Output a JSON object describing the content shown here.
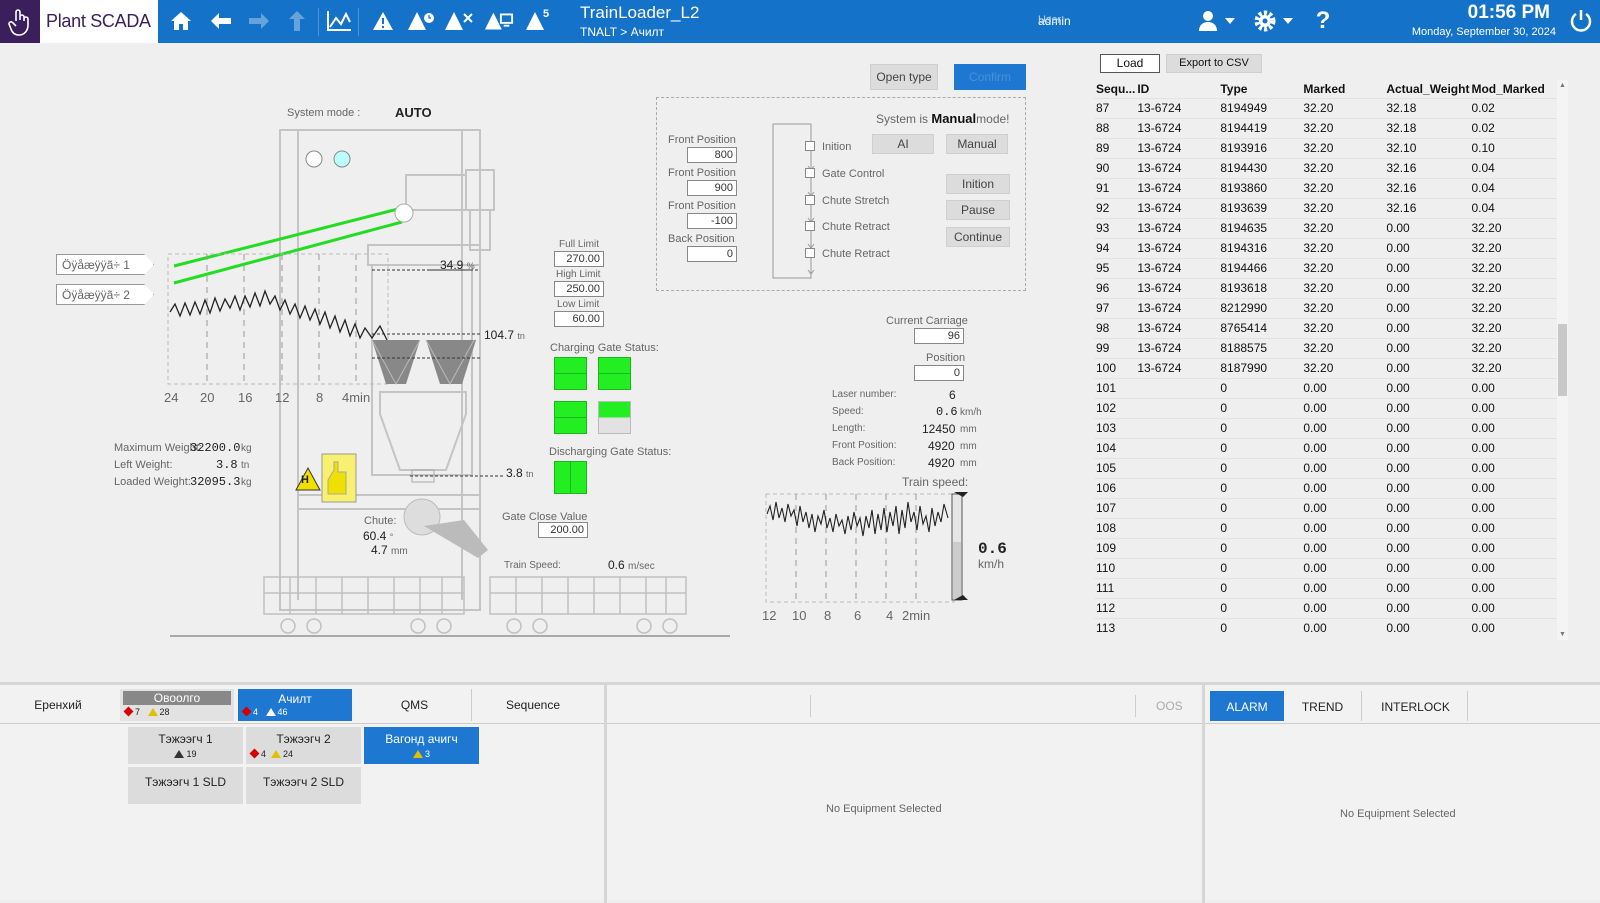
{
  "header": {
    "app_name": "Plant SCADA",
    "title": "TrainLoader_L2",
    "breadcrumb": "TNALT > Ачилт",
    "user_label": "User:",
    "user_name": "admin",
    "time": "01:56 PM",
    "date": "Monday, September 30, 2024",
    "alarm_count_badge": "5",
    "icons": [
      "home-icon",
      "back-icon",
      "forward-icon",
      "up-icon",
      "trend-icon",
      "alarm-icon",
      "alarm-clock-icon",
      "alarm-clear-icon",
      "alarm-screen-icon",
      "alarm-count-icon",
      "user-icon",
      "gear-icon",
      "help-icon",
      "power-icon"
    ]
  },
  "mimic": {
    "system_mode_label": "System mode :",
    "system_mode_value": "AUTO",
    "conveyor1_label": "Öÿåæÿÿã÷ 1",
    "conveyor2_label": "Öÿåæÿÿã÷ 2",
    "axis_ticks": [
      "24",
      "20",
      "16",
      "12",
      "8",
      "4min"
    ],
    "level_top": "34.9",
    "level_top_unit": "%",
    "level_mid": "104.7",
    "level_mid_unit": "tn",
    "level_bottom": "3.8",
    "level_bottom_unit": "tn",
    "max_weight_label": "Maximum Weight:",
    "max_weight_value": "32200.0",
    "max_weight_unit": "kg",
    "left_weight_label": "Left Weight:",
    "left_weight_value": "3.8",
    "left_weight_unit": "tn",
    "loaded_weight_label": "Loaded Weight:",
    "loaded_weight_value": "32095.3",
    "loaded_weight_unit": "kg",
    "hazard_letter": "H",
    "chute_label": "Chute:",
    "chute_angle": "60.4",
    "chute_angle_unit": "°",
    "chute_mm": "4.7",
    "chute_mm_unit": "mm"
  },
  "limits": {
    "full_label": "Full Limit",
    "full_value": "270.00",
    "high_label": "High Limit",
    "high_value": "250.00",
    "low_label": "Low Limit",
    "low_value": "60.00"
  },
  "gates": {
    "charging_label": "Charging Gate Status:",
    "discharging_label": "Discharging Gate Status:",
    "close_value_label": "Gate Close Value",
    "close_value": "200.00",
    "train_speed_label": "Train Speed:",
    "train_speed_value": "0.6",
    "train_speed_unit": "m/sec"
  },
  "control": {
    "open_type_label": "Open type",
    "confirm_label": "Confirm",
    "system_is_label": "System is",
    "system_is_mode": "Manual",
    "system_is_suffix": "mode!",
    "front_pos_label": "Front Position",
    "front_pos_1": "800",
    "front_pos_2": "900",
    "front_pos_3": "-100",
    "back_pos_label": "Back Position",
    "back_pos": "0",
    "steps": [
      "Inition",
      "Gate Control",
      "Chute Stretch",
      "Chute Retract",
      "Chute Retract"
    ],
    "ai_label": "AI",
    "manual_label": "Manual",
    "inition_label": "Inition",
    "pause_label": "Pause",
    "continue_label": "Continue"
  },
  "carriage": {
    "current_label": "Current Carriage",
    "current_value": "96",
    "position_label": "Position",
    "position_value": "0",
    "laser_label": "Laser number:",
    "laser_value": "6",
    "speed_label": "Speed:",
    "speed_value": "0.6",
    "speed_unit": "km/h",
    "length_label": "Length:",
    "length_value": "12450",
    "length_unit": "mm",
    "front_label": "Front Position:",
    "front_value": "4920",
    "front_unit": "mm",
    "back_label": "Back Position:",
    "back_value": "4920",
    "back_unit": "mm",
    "train_speed_title": "Train speed:",
    "gauge_value": "0.6",
    "gauge_unit": "km/h",
    "axis_ticks": [
      "12",
      "10",
      "8",
      "6",
      "4",
      "2min"
    ]
  },
  "table": {
    "load_label": "Load",
    "export_label": "Export to CSV",
    "columns": [
      "Sequ...",
      "ID",
      "Type",
      "Marked",
      "Actual_Weight",
      "Mod_Marked"
    ],
    "rows": [
      [
        "87",
        "13-6724",
        "8194949",
        "32.20",
        "32.18",
        "0.02"
      ],
      [
        "88",
        "13-6724",
        "8194419",
        "32.20",
        "32.18",
        "0.02"
      ],
      [
        "89",
        "13-6724",
        "8193916",
        "32.20",
        "32.10",
        "0.10"
      ],
      [
        "90",
        "13-6724",
        "8194430",
        "32.20",
        "32.16",
        "0.04"
      ],
      [
        "91",
        "13-6724",
        "8193860",
        "32.20",
        "32.16",
        "0.04"
      ],
      [
        "92",
        "13-6724",
        "8193639",
        "32.20",
        "32.16",
        "0.04"
      ],
      [
        "93",
        "13-6724",
        "8194635",
        "32.20",
        "0.00",
        "32.20"
      ],
      [
        "94",
        "13-6724",
        "8194316",
        "32.20",
        "0.00",
        "32.20"
      ],
      [
        "95",
        "13-6724",
        "8194466",
        "32.20",
        "0.00",
        "32.20"
      ],
      [
        "96",
        "13-6724",
        "8193618",
        "32.20",
        "0.00",
        "32.20"
      ],
      [
        "97",
        "13-6724",
        "8212990",
        "32.20",
        "0.00",
        "32.20"
      ],
      [
        "98",
        "13-6724",
        "8765414",
        "32.20",
        "0.00",
        "32.20"
      ],
      [
        "99",
        "13-6724",
        "8188575",
        "32.20",
        "0.00",
        "32.20"
      ],
      [
        "100",
        "13-6724",
        "8187990",
        "32.20",
        "0.00",
        "32.20"
      ],
      [
        "101",
        "",
        "0",
        "0.00",
        "0.00",
        "0.00"
      ],
      [
        "102",
        "",
        "0",
        "0.00",
        "0.00",
        "0.00"
      ],
      [
        "103",
        "",
        "0",
        "0.00",
        "0.00",
        "0.00"
      ],
      [
        "104",
        "",
        "0",
        "0.00",
        "0.00",
        "0.00"
      ],
      [
        "105",
        "",
        "0",
        "0.00",
        "0.00",
        "0.00"
      ],
      [
        "106",
        "",
        "0",
        "0.00",
        "0.00",
        "0.00"
      ],
      [
        "107",
        "",
        "0",
        "0.00",
        "0.00",
        "0.00"
      ],
      [
        "108",
        "",
        "0",
        "0.00",
        "0.00",
        "0.00"
      ],
      [
        "109",
        "",
        "0",
        "0.00",
        "0.00",
        "0.00"
      ],
      [
        "110",
        "",
        "0",
        "0.00",
        "0.00",
        "0.00"
      ],
      [
        "111",
        "",
        "0",
        "0.00",
        "0.00",
        "0.00"
      ],
      [
        "112",
        "",
        "0",
        "0.00",
        "0.00",
        "0.00"
      ],
      [
        "113",
        "",
        "0",
        "0.00",
        "0.00",
        "0.00"
      ]
    ]
  },
  "bottom": {
    "tabs": {
      "general": "Еренхий",
      "ovoolgo": "Овоолго",
      "ovoolgo_red": "7",
      "ovoolgo_yellow": "28",
      "achilt": "Ачилт",
      "achilt_red": "4",
      "achilt_yellow": "46",
      "qms": "QMS",
      "sequence": "Sequence"
    },
    "subtabs": {
      "t1": "Тэжээгч 1",
      "t1_count": "19",
      "t2": "Тэжээгч 2",
      "t2_red": "4",
      "t2_yellow": "24",
      "wagon": "Вагонд ачигч",
      "wagon_count": "3",
      "t1sld": "Тэжээгч 1 SLD",
      "t2sld": "Тэжээгч 2 SLD"
    },
    "oos_label": "OOS",
    "no_equipment_mid": "No Equipment Selected",
    "right_tabs": [
      "ALARM",
      "TREND",
      "INTERLOCK"
    ],
    "no_equipment_right": "No Equipment Selected"
  },
  "colors": {
    "header": "#1472c8",
    "active_tab": "#1e78d2",
    "gate_open": "#22ee22",
    "conveyor": "#22dd22"
  }
}
